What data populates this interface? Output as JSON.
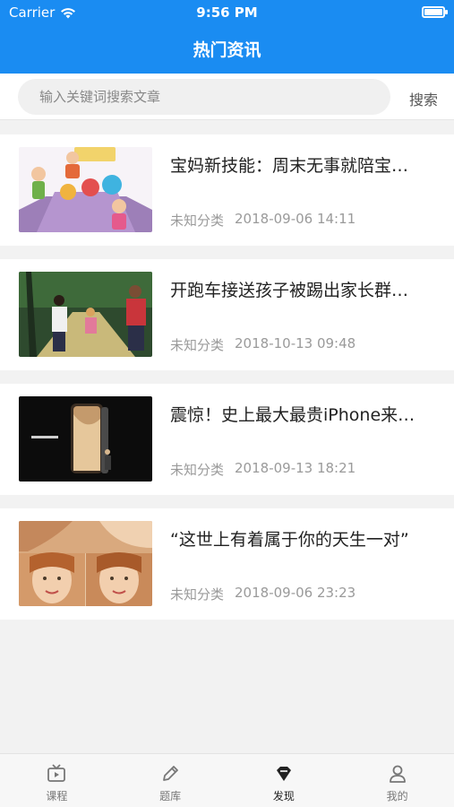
{
  "status_bar": {
    "carrier": "Carrier",
    "time": "9:56 PM",
    "battery_level": 1.0
  },
  "header": {
    "title": "热门资讯"
  },
  "search": {
    "placeholder": "输入关键词搜索文章",
    "button_label": "搜索"
  },
  "articles": [
    {
      "title": "宝妈新技能：周末无事就陪宝…",
      "category": "未知分类",
      "date": "2018-09-06 14:11",
      "thumb_icon": "kids-playing-image"
    },
    {
      "title": "开跑车接送孩子被踢出家长群…",
      "category": "未知分类",
      "date": "2018-10-13 09:48",
      "thumb_icon": "family-walking-image"
    },
    {
      "title": "震惊！史上最大最贵iPhone来…",
      "category": "未知分类",
      "date": "2018-09-13 18:21",
      "thumb_icon": "iphone-keynote-image"
    },
    {
      "title": "“这世上有着属于你的天生一对”",
      "category": "未知分类",
      "date": "2018-09-06 23:23",
      "thumb_icon": "twins-portrait-image"
    }
  ],
  "tabbar": {
    "tabs": [
      {
        "label": "课程",
        "icon": "course-icon",
        "active": false
      },
      {
        "label": "题库",
        "icon": "pencil-icon",
        "active": false
      },
      {
        "label": "发现",
        "icon": "discover-icon",
        "active": true
      },
      {
        "label": "我的",
        "icon": "profile-icon",
        "active": false
      }
    ]
  },
  "colors": {
    "accent": "#1a8cf2",
    "background": "#f2f2f2",
    "meta_text": "#9a9a9a"
  }
}
